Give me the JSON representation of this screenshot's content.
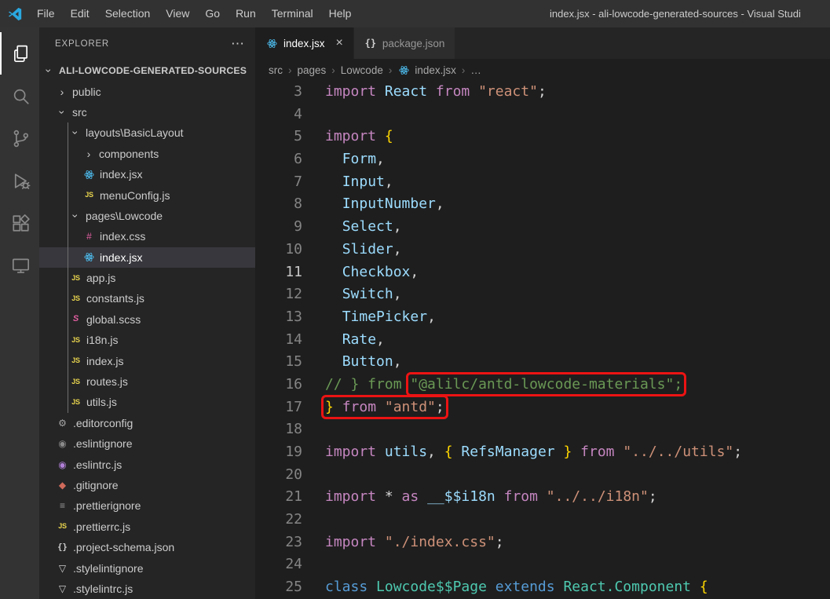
{
  "window": {
    "title": "index.jsx - ali-lowcode-generated-sources - Visual Studi"
  },
  "menubar": {
    "items": [
      "File",
      "Edit",
      "Selection",
      "View",
      "Go",
      "Run",
      "Terminal",
      "Help"
    ]
  },
  "activity_bar": {
    "items": [
      {
        "name": "explorer",
        "active": true
      },
      {
        "name": "search",
        "active": false
      },
      {
        "name": "source-control",
        "active": false
      },
      {
        "name": "run-debug",
        "active": false
      },
      {
        "name": "extensions",
        "active": false
      },
      {
        "name": "remote-explorer",
        "active": false
      }
    ]
  },
  "sidebar": {
    "header": "EXPLORER",
    "more_actions": "⋯",
    "root": {
      "label": "ALI-LOWCODE-GENERATED-SOURCES",
      "expanded": true
    },
    "items": [
      {
        "label": "public",
        "depth": 1,
        "kind": "folder",
        "chev": "collapsed"
      },
      {
        "label": "src",
        "depth": 1,
        "kind": "folder",
        "chev": "expanded"
      },
      {
        "label": "layouts\\BasicLayout",
        "depth": 2,
        "kind": "folder",
        "chev": "expanded"
      },
      {
        "label": "components",
        "depth": 3,
        "kind": "folder",
        "chev": "collapsed"
      },
      {
        "label": "index.jsx",
        "depth": 3,
        "kind": "file",
        "icon": "react"
      },
      {
        "label": "menuConfig.js",
        "depth": 3,
        "kind": "file",
        "icon": "js"
      },
      {
        "label": "pages\\Lowcode",
        "depth": 2,
        "kind": "folder",
        "chev": "expanded"
      },
      {
        "label": "index.css",
        "depth": 3,
        "kind": "file",
        "icon": "css"
      },
      {
        "label": "index.jsx",
        "depth": 3,
        "kind": "file",
        "icon": "react",
        "selected": true
      },
      {
        "label": "app.js",
        "depth": 2,
        "kind": "file",
        "icon": "js"
      },
      {
        "label": "constants.js",
        "depth": 2,
        "kind": "file",
        "icon": "js"
      },
      {
        "label": "global.scss",
        "depth": 2,
        "kind": "file",
        "icon": "scss"
      },
      {
        "label": "i18n.js",
        "depth": 2,
        "kind": "file",
        "icon": "js"
      },
      {
        "label": "index.js",
        "depth": 2,
        "kind": "file",
        "icon": "js"
      },
      {
        "label": "routes.js",
        "depth": 2,
        "kind": "file",
        "icon": "js"
      },
      {
        "label": "utils.js",
        "depth": 2,
        "kind": "file",
        "icon": "js"
      },
      {
        "label": ".editorconfig",
        "depth": 1,
        "kind": "file",
        "icon": "editorconfig"
      },
      {
        "label": ".eslintignore",
        "depth": 1,
        "kind": "file",
        "icon": "eslint-gray"
      },
      {
        "label": ".eslintrc.js",
        "depth": 1,
        "kind": "file",
        "icon": "eslint"
      },
      {
        "label": ".gitignore",
        "depth": 1,
        "kind": "file",
        "icon": "git"
      },
      {
        "label": ".prettierignore",
        "depth": 1,
        "kind": "file",
        "icon": "prettier"
      },
      {
        "label": ".prettierrc.js",
        "depth": 1,
        "kind": "file",
        "icon": "js"
      },
      {
        "label": ".project-schema.json",
        "depth": 1,
        "kind": "file",
        "icon": "json"
      },
      {
        "label": ".stylelintignore",
        "depth": 1,
        "kind": "file",
        "icon": "stylelint"
      },
      {
        "label": ".stylelintrc.js",
        "depth": 1,
        "kind": "file",
        "icon": "stylelint"
      }
    ]
  },
  "tabbar": {
    "tabs": [
      {
        "label": "index.jsx",
        "icon": "react",
        "active": true,
        "close_glyph": "×"
      },
      {
        "label": "package.json",
        "icon": "json",
        "active": false
      }
    ]
  },
  "breadcrumb": {
    "separator": "›",
    "segments": [
      {
        "label": "src"
      },
      {
        "label": "pages"
      },
      {
        "label": "Lowcode"
      },
      {
        "label": "index.jsx",
        "icon": "react"
      },
      {
        "label": "…"
      }
    ]
  },
  "editor": {
    "lines": [
      {
        "n": 3,
        "t": [
          [
            "k",
            "import "
          ],
          [
            "v",
            "React "
          ],
          [
            "k",
            "from "
          ],
          [
            "s",
            "\"react\""
          ],
          [
            "p",
            ";"
          ]
        ]
      },
      {
        "n": 4,
        "t": []
      },
      {
        "n": 5,
        "t": [
          [
            "k",
            "import "
          ],
          [
            "b",
            "{"
          ]
        ]
      },
      {
        "n": 6,
        "t": [
          [
            "p",
            "  "
          ],
          [
            "v",
            "Form"
          ],
          [
            "p",
            ","
          ]
        ]
      },
      {
        "n": 7,
        "t": [
          [
            "p",
            "  "
          ],
          [
            "v",
            "Input"
          ],
          [
            "p",
            ","
          ]
        ]
      },
      {
        "n": 8,
        "t": [
          [
            "p",
            "  "
          ],
          [
            "v",
            "InputNumber"
          ],
          [
            "p",
            ","
          ]
        ]
      },
      {
        "n": 9,
        "t": [
          [
            "p",
            "  "
          ],
          [
            "v",
            "Select"
          ],
          [
            "p",
            ","
          ]
        ]
      },
      {
        "n": 10,
        "t": [
          [
            "p",
            "  "
          ],
          [
            "v",
            "Slider"
          ],
          [
            "p",
            ","
          ]
        ]
      },
      {
        "n": 11,
        "current": true,
        "t": [
          [
            "p",
            "  "
          ],
          [
            "v",
            "Checkbox"
          ],
          [
            "p",
            ","
          ]
        ]
      },
      {
        "n": 12,
        "t": [
          [
            "p",
            "  "
          ],
          [
            "v",
            "Switch"
          ],
          [
            "p",
            ","
          ]
        ]
      },
      {
        "n": 13,
        "t": [
          [
            "p",
            "  "
          ],
          [
            "v",
            "TimePicker"
          ],
          [
            "p",
            ","
          ]
        ]
      },
      {
        "n": 14,
        "t": [
          [
            "p",
            "  "
          ],
          [
            "v",
            "Rate"
          ],
          [
            "p",
            ","
          ]
        ]
      },
      {
        "n": 15,
        "t": [
          [
            "p",
            "  "
          ],
          [
            "v",
            "Button"
          ],
          [
            "p",
            ","
          ]
        ]
      },
      {
        "n": 16,
        "t": [
          [
            "c",
            "// } from "
          ],
          [
            "c",
            "\"@alilc/antd-lowcode-materials\";",
            "box"
          ]
        ]
      },
      {
        "n": 17,
        "t": [
          [
            "b",
            "} ",
            "box"
          ],
          [
            "k",
            "from ",
            "box"
          ],
          [
            "s",
            "\"antd\"",
            "box"
          ],
          [
            "p",
            ";",
            "box"
          ]
        ]
      },
      {
        "n": 18,
        "t": []
      },
      {
        "n": 19,
        "t": [
          [
            "k",
            "import "
          ],
          [
            "v",
            "utils"
          ],
          [
            "p",
            ", "
          ],
          [
            "b",
            "{ "
          ],
          [
            "v",
            "RefsManager"
          ],
          [
            "b",
            " }"
          ],
          [
            "p",
            " "
          ],
          [
            "k",
            "from "
          ],
          [
            "s",
            "\"../../utils\""
          ],
          [
            "p",
            ";"
          ]
        ]
      },
      {
        "n": 20,
        "t": []
      },
      {
        "n": 21,
        "t": [
          [
            "k",
            "import "
          ],
          [
            "p",
            "* "
          ],
          [
            "k",
            "as "
          ],
          [
            "v",
            "__$$i18n "
          ],
          [
            "k",
            "from "
          ],
          [
            "s",
            "\"../../i18n\""
          ],
          [
            "p",
            ";"
          ]
        ]
      },
      {
        "n": 22,
        "t": []
      },
      {
        "n": 23,
        "t": [
          [
            "k",
            "import "
          ],
          [
            "s",
            "\"./index.css\""
          ],
          [
            "p",
            ";"
          ]
        ]
      },
      {
        "n": 24,
        "t": []
      },
      {
        "n": 25,
        "t": [
          [
            "k2",
            "class "
          ],
          [
            "cl",
            "Lowcode$$Page "
          ],
          [
            "k2",
            "extends "
          ],
          [
            "cl",
            "React.Component "
          ],
          [
            "b",
            "{"
          ]
        ]
      }
    ]
  },
  "colors": {
    "kw": "#c586c0",
    "kw2": "#569cd6",
    "variable": "#9cdcfe",
    "string": "#ce9178",
    "punct": "#d4d4d4",
    "brace": "#ffd700",
    "comment": "#6a9955",
    "classname": "#4ec9b0",
    "annotation": "#ec1313",
    "react_icon": "#4fc3f7",
    "js_icon": "#e8d44d",
    "editor_bg": "#1e1e1e",
    "sidebar_bg": "#252526",
    "activity_bg": "#333333",
    "title_bg": "#323233"
  }
}
